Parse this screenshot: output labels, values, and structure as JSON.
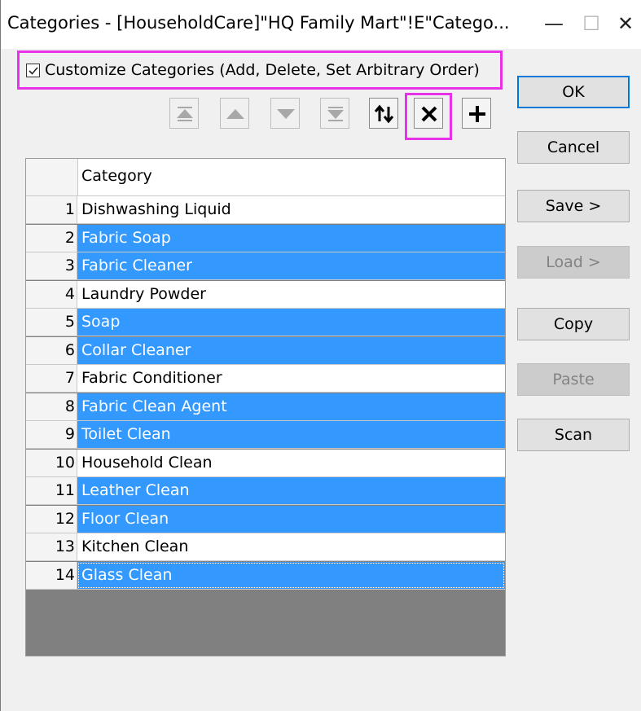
{
  "window": {
    "title": "Categories - [HouseholdCare]\"HQ Family Mart\"!E\"Catego...",
    "minimize_glyph": "—",
    "maximize_glyph": "☐",
    "close_glyph": "✕"
  },
  "customize": {
    "checked": true,
    "label": "Customize Categories (Add, Delete, Set Arbitrary Order)"
  },
  "toolbar": [
    {
      "icon": "move-to-top-icon",
      "enabled": false
    },
    {
      "icon": "move-up-icon",
      "enabled": false
    },
    {
      "icon": "move-down-icon",
      "enabled": false
    },
    {
      "icon": "move-to-bottom-icon",
      "enabled": false
    },
    {
      "icon": "sort-icon",
      "enabled": true
    },
    {
      "icon": "delete-icon",
      "enabled": true,
      "highlighted": true
    },
    {
      "icon": "add-icon",
      "enabled": true
    }
  ],
  "grid": {
    "header": "Category",
    "rows": [
      {
        "num": "1",
        "name": "Dishwashing Liquid",
        "selected": false
      },
      {
        "num": "2",
        "name": "Fabric Soap",
        "selected": true
      },
      {
        "num": "3",
        "name": "Fabric Cleaner",
        "selected": true
      },
      {
        "num": "4",
        "name": "Laundry Powder",
        "selected": false
      },
      {
        "num": "5",
        "name": "Soap",
        "selected": true
      },
      {
        "num": "6",
        "name": "Collar Cleaner",
        "selected": true
      },
      {
        "num": "7",
        "name": "Fabric Conditioner",
        "selected": false
      },
      {
        "num": "8",
        "name": "Fabric Clean Agent",
        "selected": true
      },
      {
        "num": "9",
        "name": "Toilet Clean",
        "selected": true
      },
      {
        "num": "10",
        "name": "Household Clean",
        "selected": false
      },
      {
        "num": "11",
        "name": "Leather Clean",
        "selected": true
      },
      {
        "num": "12",
        "name": "Floor Clean",
        "selected": true
      },
      {
        "num": "13",
        "name": "Kitchen Clean",
        "selected": false
      },
      {
        "num": "14",
        "name": "Glass Clean",
        "selected": true
      }
    ]
  },
  "buttons": {
    "ok": "OK",
    "cancel": "Cancel",
    "save": "Save >",
    "load": "Load >",
    "copy": "Copy",
    "paste": "Paste",
    "scan": "Scan"
  },
  "colors": {
    "selection": "#3399ff",
    "highlight": "#e832e8",
    "default_button_border": "#0078d7"
  }
}
